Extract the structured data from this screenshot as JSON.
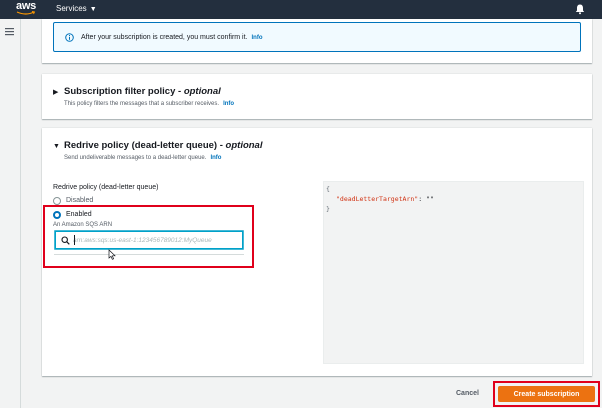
{
  "topbar": {
    "logo_text": "aws",
    "services_label": "Services",
    "icons": {
      "services_caret": "caret-down-icon",
      "notifications": "bell-icon"
    }
  },
  "sidebar": {
    "menu_icon": "hamburger-icon"
  },
  "info_alert": {
    "text": "After your subscription is created, you must confirm it.",
    "info_link": "Info",
    "icon": "info-circle-icon"
  },
  "subscription_filter": {
    "title": "Subscription filter policy - ",
    "title_optional": "optional",
    "description": "This policy filters the messages that a subscriber receives.",
    "info_link": "Info",
    "expanded": false
  },
  "redrive": {
    "title": "Redrive policy (dead-letter queue) - ",
    "title_optional": "optional",
    "description": "Send undeliverable messages to a dead-letter queue.",
    "info_link": "Info",
    "expanded": true,
    "field_label": "Redrive policy (dead-letter queue)",
    "options": [
      {
        "label": "Disabled",
        "selected": false
      },
      {
        "label": "Enabled",
        "selected": true,
        "description": "An Amazon SQS ARN"
      }
    ],
    "arn_placeholder": "arn:aws:sqs:us-east-1:123456789012:MyQueue",
    "arn_value": ""
  },
  "json_preview": {
    "open_brace": "{",
    "key": "\"deadLetterTargetArn\"",
    "colon": ":",
    "value": "\"\"",
    "close_brace": "}"
  },
  "footer": {
    "cancel_label": "Cancel",
    "create_label": "Create subscription"
  },
  "colors": {
    "topbar_bg": "#232f3e",
    "link": "#0073bb",
    "primary_button": "#ec7211",
    "highlight_box": "#e0001b",
    "json_key": "#d13212",
    "input_focus": "#00a1c9"
  }
}
